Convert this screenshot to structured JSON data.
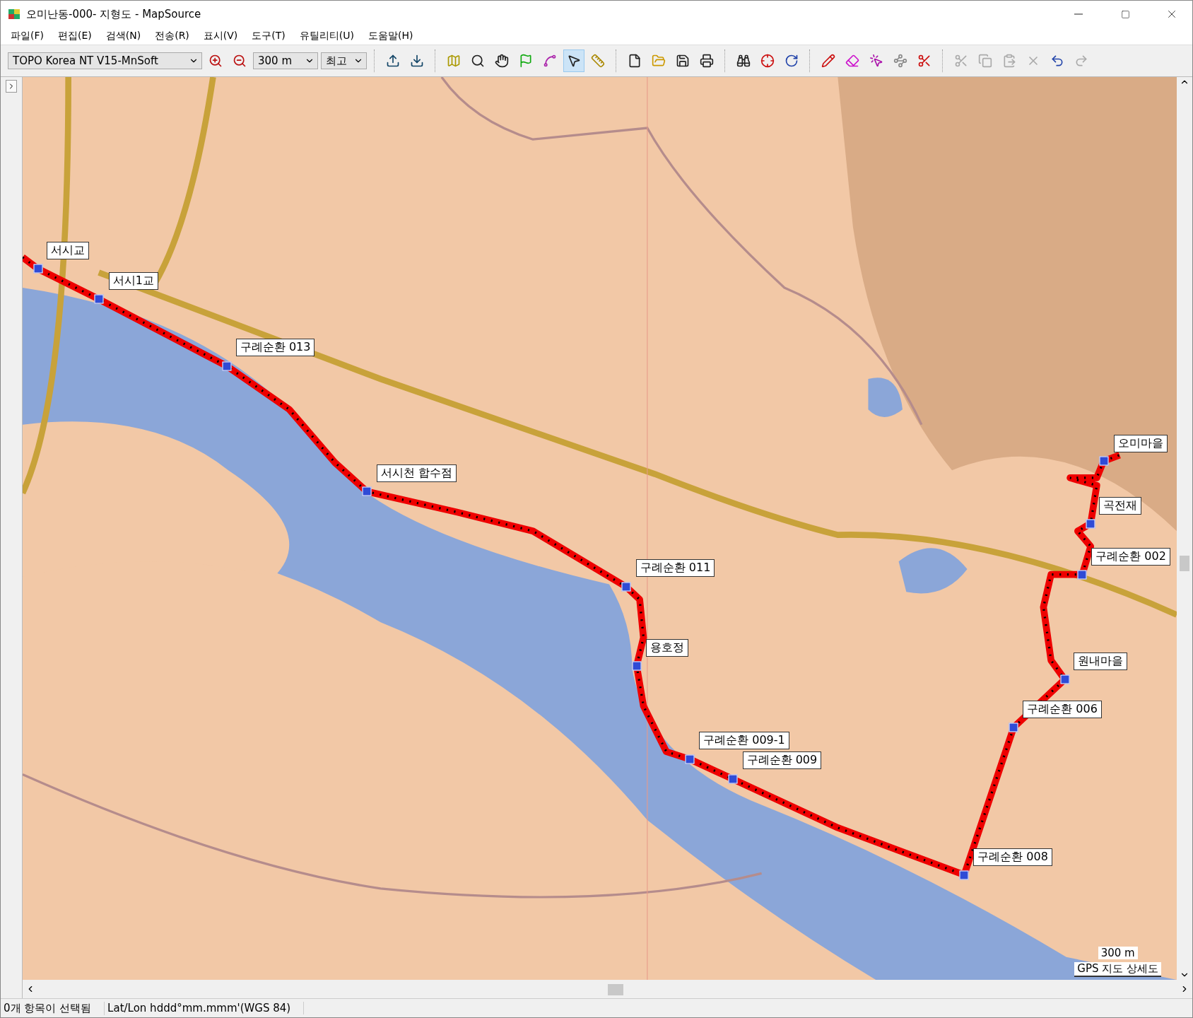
{
  "window": {
    "title": "오미난동-000- 지형도 - MapSource"
  },
  "menu": [
    "파일(F)",
    "편집(E)",
    "검색(N)",
    "전송(R)",
    "표시(V)",
    "도구(T)",
    "유틸리티(U)",
    "도움말(H)"
  ],
  "toolbar": {
    "map_product": "TOPO Korea NT V15-MnSoft",
    "zoom_scale": "300 m",
    "detail": "최고",
    "groups": [
      [
        {
          "kind": "zoomin"
        },
        {
          "kind": "zoomout"
        }
      ],
      [
        {
          "kind": "send"
        },
        {
          "kind": "receive"
        }
      ],
      [
        {
          "kind": "map",
          "selected": false
        },
        {
          "kind": "zoom",
          "selected": false
        },
        {
          "kind": "pan",
          "selected": false
        },
        {
          "kind": "waypoint",
          "selected": false
        },
        {
          "kind": "route",
          "selected": false
        },
        {
          "kind": "select",
          "selected": true
        },
        {
          "kind": "measure",
          "selected": false
        }
      ],
      [
        {
          "kind": "new"
        },
        {
          "kind": "open"
        },
        {
          "kind": "save"
        },
        {
          "kind": "print"
        }
      ],
      [
        {
          "kind": "find"
        },
        {
          "kind": "findnear"
        },
        {
          "kind": "findnext"
        }
      ],
      [
        {
          "kind": "draw"
        },
        {
          "kind": "erase"
        },
        {
          "kind": "lasso"
        },
        {
          "kind": "join"
        },
        {
          "kind": "divide"
        }
      ],
      [
        {
          "kind": "cut",
          "disabled": true
        },
        {
          "kind": "copy",
          "disabled": true
        },
        {
          "kind": "paste",
          "disabled": true
        },
        {
          "kind": "delete",
          "disabled": true
        },
        {
          "kind": "undo",
          "disabled": false
        },
        {
          "kind": "redo",
          "disabled": true
        }
      ]
    ]
  },
  "map": {
    "waypoints": [
      "서시교",
      "서시1교",
      "구례순환 013",
      "오미마을",
      "서시천 합수점",
      "곡전재",
      "구례순환 002",
      "구례순환 011",
      "용호정",
      "원내마을",
      "구례순환 006",
      "구례순환 009-1",
      "구례순환 009",
      "구례순환 008"
    ],
    "scale": "300 m",
    "detail_label": "GPS 지도 상세도"
  },
  "status_bar": [
    "0개 항목이 선택됨",
    "Lat/Lon hddd°mm.mmm'(WGS 84)"
  ]
}
